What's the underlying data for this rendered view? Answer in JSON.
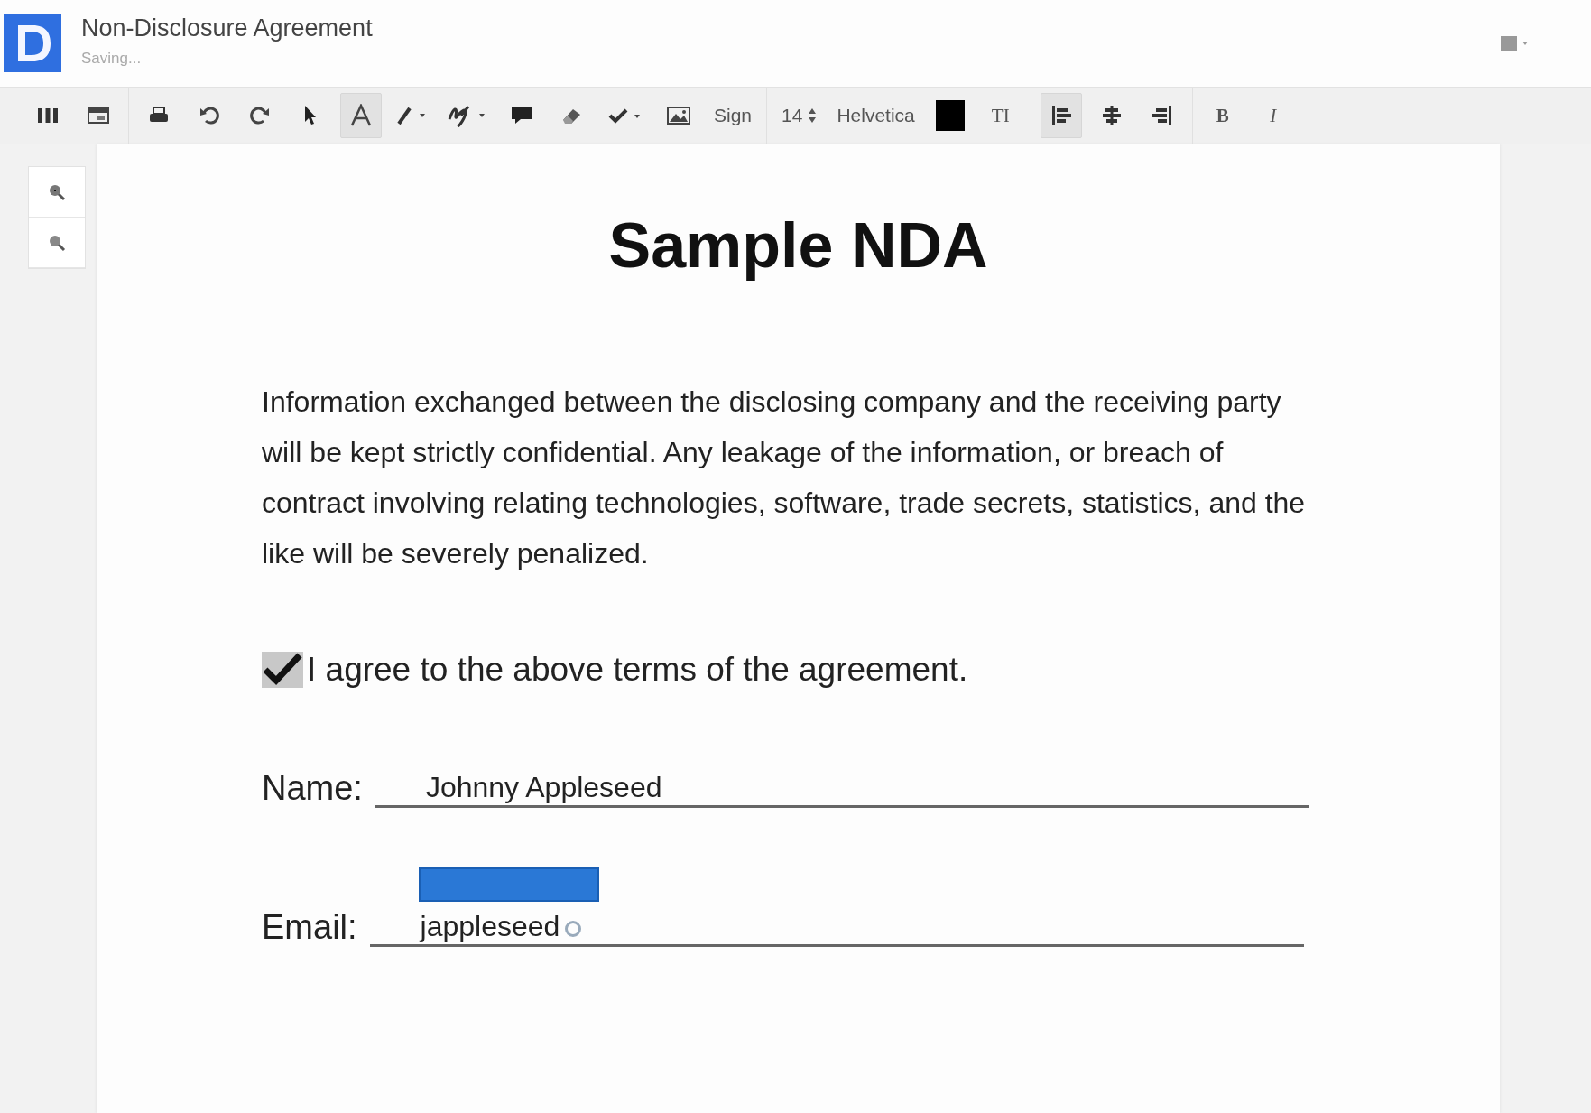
{
  "header": {
    "title": "Non-Disclosure Agreement",
    "status": "Saving..."
  },
  "toolbar": [
    {
      "kind": "icon",
      "selected": false
    },
    {
      "kind": "icon",
      "selected": false
    },
    {
      "kind": "separator"
    },
    {
      "kind": "icon",
      "selected": false
    },
    {
      "kind": "icon",
      "selected": false
    },
    {
      "kind": "icon",
      "selected": false
    },
    {
      "kind": "icon",
      "selected": false
    },
    {
      "kind": "icon",
      "selected": true
    },
    {
      "kind": "icon-caret",
      "selected": false
    },
    {
      "kind": "icon-caret",
      "selected": false
    },
    {
      "kind": "icon",
      "selected": false
    },
    {
      "kind": "icon",
      "selected": false
    },
    {
      "kind": "icon-caret",
      "selected": false
    },
    {
      "kind": "icon",
      "selected": false
    },
    {
      "kind": "text",
      "label": "Sign"
    },
    {
      "kind": "separator"
    },
    {
      "kind": "stepper",
      "label": "14"
    },
    {
      "kind": "text",
      "label": "Helvetica"
    },
    {
      "kind": "swatch",
      "color": "#000000"
    },
    {
      "kind": "serif",
      "label": "TI"
    },
    {
      "kind": "separator"
    },
    {
      "kind": "icon",
      "selected": true
    },
    {
      "kind": "icon",
      "selected": false
    },
    {
      "kind": "icon",
      "selected": false
    },
    {
      "kind": "separator"
    },
    {
      "kind": "bold",
      "label": "B"
    },
    {
      "kind": "italic",
      "label": "I"
    }
  ],
  "document": {
    "title": "Sample NDA",
    "paragraph": "Information exchanged between the disclosing company and the receiving party will be kept strictly confidential. Any leakage of the information, or breach of contract involving relating technologies, software, trade secrets, statistics, and the like will be severely penalized.",
    "agreement": {
      "label": "I agree to the above terms of the agreement.",
      "checked": true
    },
    "fields": [
      {
        "label": "Name:",
        "value": "Johnny Appleseed",
        "focused": false
      },
      {
        "label": "Email:",
        "value": "jappleseed",
        "focused": true
      }
    ]
  }
}
